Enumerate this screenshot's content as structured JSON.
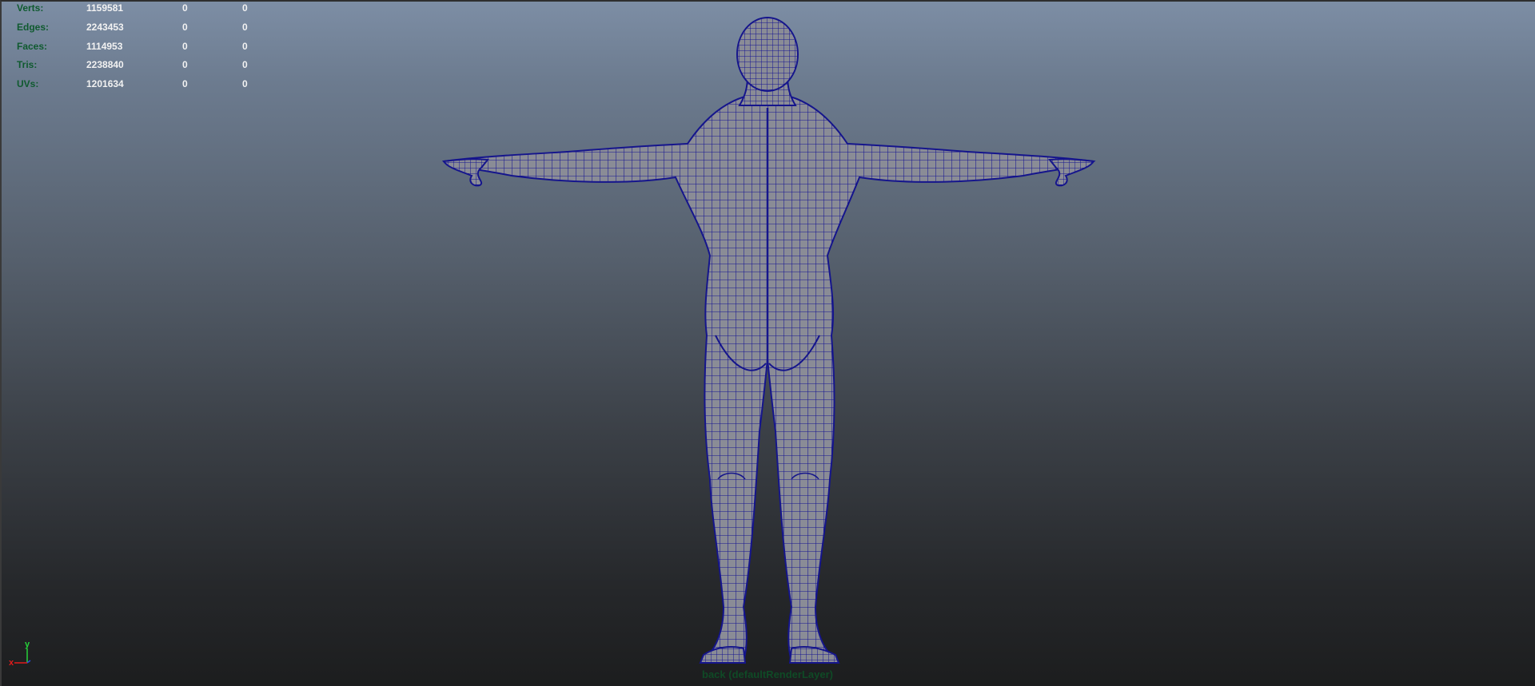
{
  "hud": {
    "rows": [
      {
        "label": "Verts:",
        "count": "1159581",
        "selected": "0",
        "component": "0"
      },
      {
        "label": "Edges:",
        "count": "2243453",
        "selected": "0",
        "component": "0"
      },
      {
        "label": "Faces:",
        "count": "1114953",
        "selected": "0",
        "component": "0"
      },
      {
        "label": "Tris:",
        "count": "2238840",
        "selected": "0",
        "component": "0"
      },
      {
        "label": "UVs:",
        "count": "1201634",
        "selected": "0",
        "component": "0"
      }
    ]
  },
  "axis_gizmo": {
    "y_label": "y",
    "x_label": "x",
    "y_color": "#26d13a",
    "x_color": "#e01b1b",
    "z_color": "#2a4bd8"
  },
  "viewport": {
    "camera_label": "back (defaultRenderLayer)",
    "mesh_surface_color": "#8a8c96",
    "wireframe_color": "#151592",
    "background_top_color": "#7d8ea5",
    "background_bottom_color": "#1c1d1e"
  }
}
